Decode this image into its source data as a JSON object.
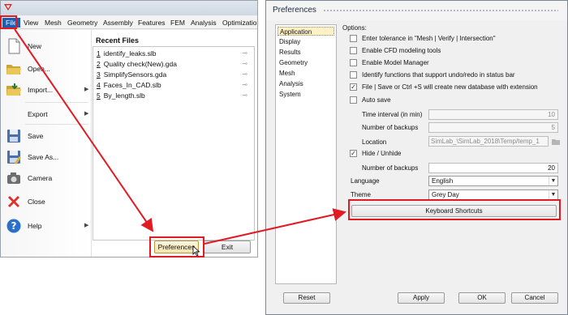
{
  "app": {
    "menu": [
      "File",
      "View",
      "Mesh",
      "Geometry",
      "Assembly",
      "Features",
      "FEM",
      "Analysis",
      "Optimization"
    ],
    "file_commands": [
      {
        "label": "New",
        "icon": "new-file-icon",
        "has_submenu": false
      },
      {
        "label": "Open...",
        "icon": "open-folder-icon",
        "has_submenu": false
      },
      {
        "label": "Import...",
        "icon": "import-icon",
        "has_submenu": true
      },
      {
        "label": "Export",
        "icon": "export-icon",
        "has_submenu": true
      },
      {
        "label": "Save",
        "icon": "save-icon",
        "has_submenu": false
      },
      {
        "label": "Save As...",
        "icon": "save-as-icon",
        "has_submenu": false
      },
      {
        "label": "Camera",
        "icon": "camera-icon",
        "has_submenu": false
      },
      {
        "label": "Close",
        "icon": "close-icon",
        "has_submenu": false
      },
      {
        "label": "Help",
        "icon": "help-icon",
        "has_submenu": true
      }
    ],
    "recent_title": "Recent Files",
    "recent_files": [
      {
        "num": "1",
        "name": "identify_leaks.slb"
      },
      {
        "num": "2",
        "name": "Quality check(New).gda"
      },
      {
        "num": "3",
        "name": "SimplifySensors.gda"
      },
      {
        "num": "4",
        "name": "Faces_In_CAD.slb"
      },
      {
        "num": "5",
        "name": "By_length.slb"
      }
    ],
    "preferences_button": "Preferences",
    "exit_button": "Exit"
  },
  "prefs": {
    "title": "Preferences",
    "categories": [
      "Application",
      "Display",
      "Results",
      "Geometry",
      "Mesh",
      "Analysis",
      "System"
    ],
    "selected_category": "Application",
    "options_label": "Options:",
    "checkboxes": [
      {
        "label": "Enter tolerance in \"Mesh | Verify | Intersection\"",
        "checked": false
      },
      {
        "label": "Enable CFD modeling tools",
        "checked": false
      },
      {
        "label": "Enable Model Manager",
        "checked": false
      },
      {
        "label": "Identify functions that support undo/redo in status bar",
        "checked": false
      },
      {
        "label": "File | Save or Ctrl +S will create new database with extension",
        "checked": true
      },
      {
        "label": "Auto save",
        "checked": false
      }
    ],
    "autosave_fields": {
      "interval_label": "Time interval (in min)",
      "interval_value": "10",
      "backups_label": "Number of backups",
      "backups_value": "5",
      "location_label": "Location",
      "location_value": "SimLab_\\SimLab_2018\\Temp/temp_1"
    },
    "hide_unhide": {
      "label": "Hide / Unhide",
      "checked": true,
      "backups_label": "Number of backups",
      "backups_value": "20"
    },
    "language": {
      "label": "Language",
      "value": "English"
    },
    "theme": {
      "label": "Theme",
      "value": "Grey Day"
    },
    "keyboard_shortcuts": "Keyboard Shortcuts",
    "buttons": {
      "reset": "Reset",
      "apply": "Apply",
      "ok": "OK",
      "cancel": "Cancel"
    }
  },
  "annotations": {
    "highlight_color": "#e01b24"
  }
}
